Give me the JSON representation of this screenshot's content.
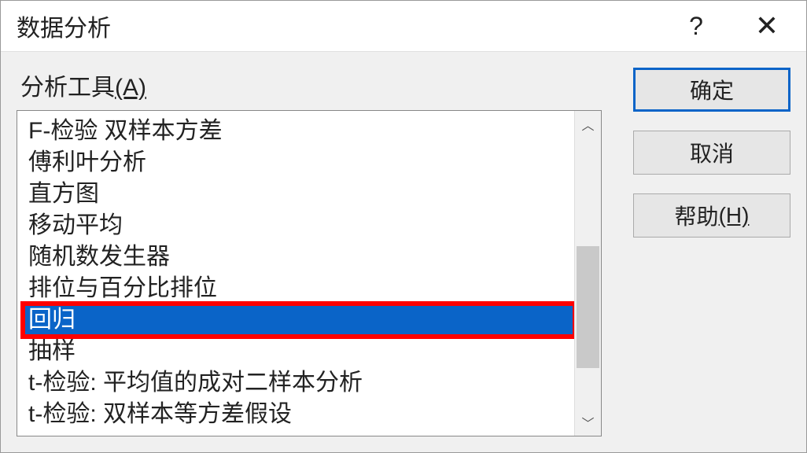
{
  "dialog": {
    "title": "数据分析",
    "help_glyph": "?",
    "close_glyph": "✕"
  },
  "section": {
    "label_text": "分析工具",
    "label_mnemonic": "(A)"
  },
  "list": {
    "items": [
      {
        "text": "F-检验 双样本方差",
        "selected": false
      },
      {
        "text": "傅利叶分析",
        "selected": false
      },
      {
        "text": "直方图",
        "selected": false
      },
      {
        "text": "移动平均",
        "selected": false
      },
      {
        "text": "随机数发生器",
        "selected": false
      },
      {
        "text": "排位与百分比排位",
        "selected": false
      },
      {
        "text": "回归",
        "selected": true
      },
      {
        "text": "抽样",
        "selected": false
      },
      {
        "text": "t-检验: 平均值的成对二样本分析",
        "selected": false
      },
      {
        "text": "t-检验: 双样本等方差假设",
        "selected": false
      }
    ]
  },
  "buttons": {
    "ok": "确定",
    "cancel": "取消",
    "help_text": "帮助",
    "help_mnemonic": "(H)"
  },
  "scroll": {
    "up_glyph": "︿",
    "down_glyph": "﹀"
  }
}
